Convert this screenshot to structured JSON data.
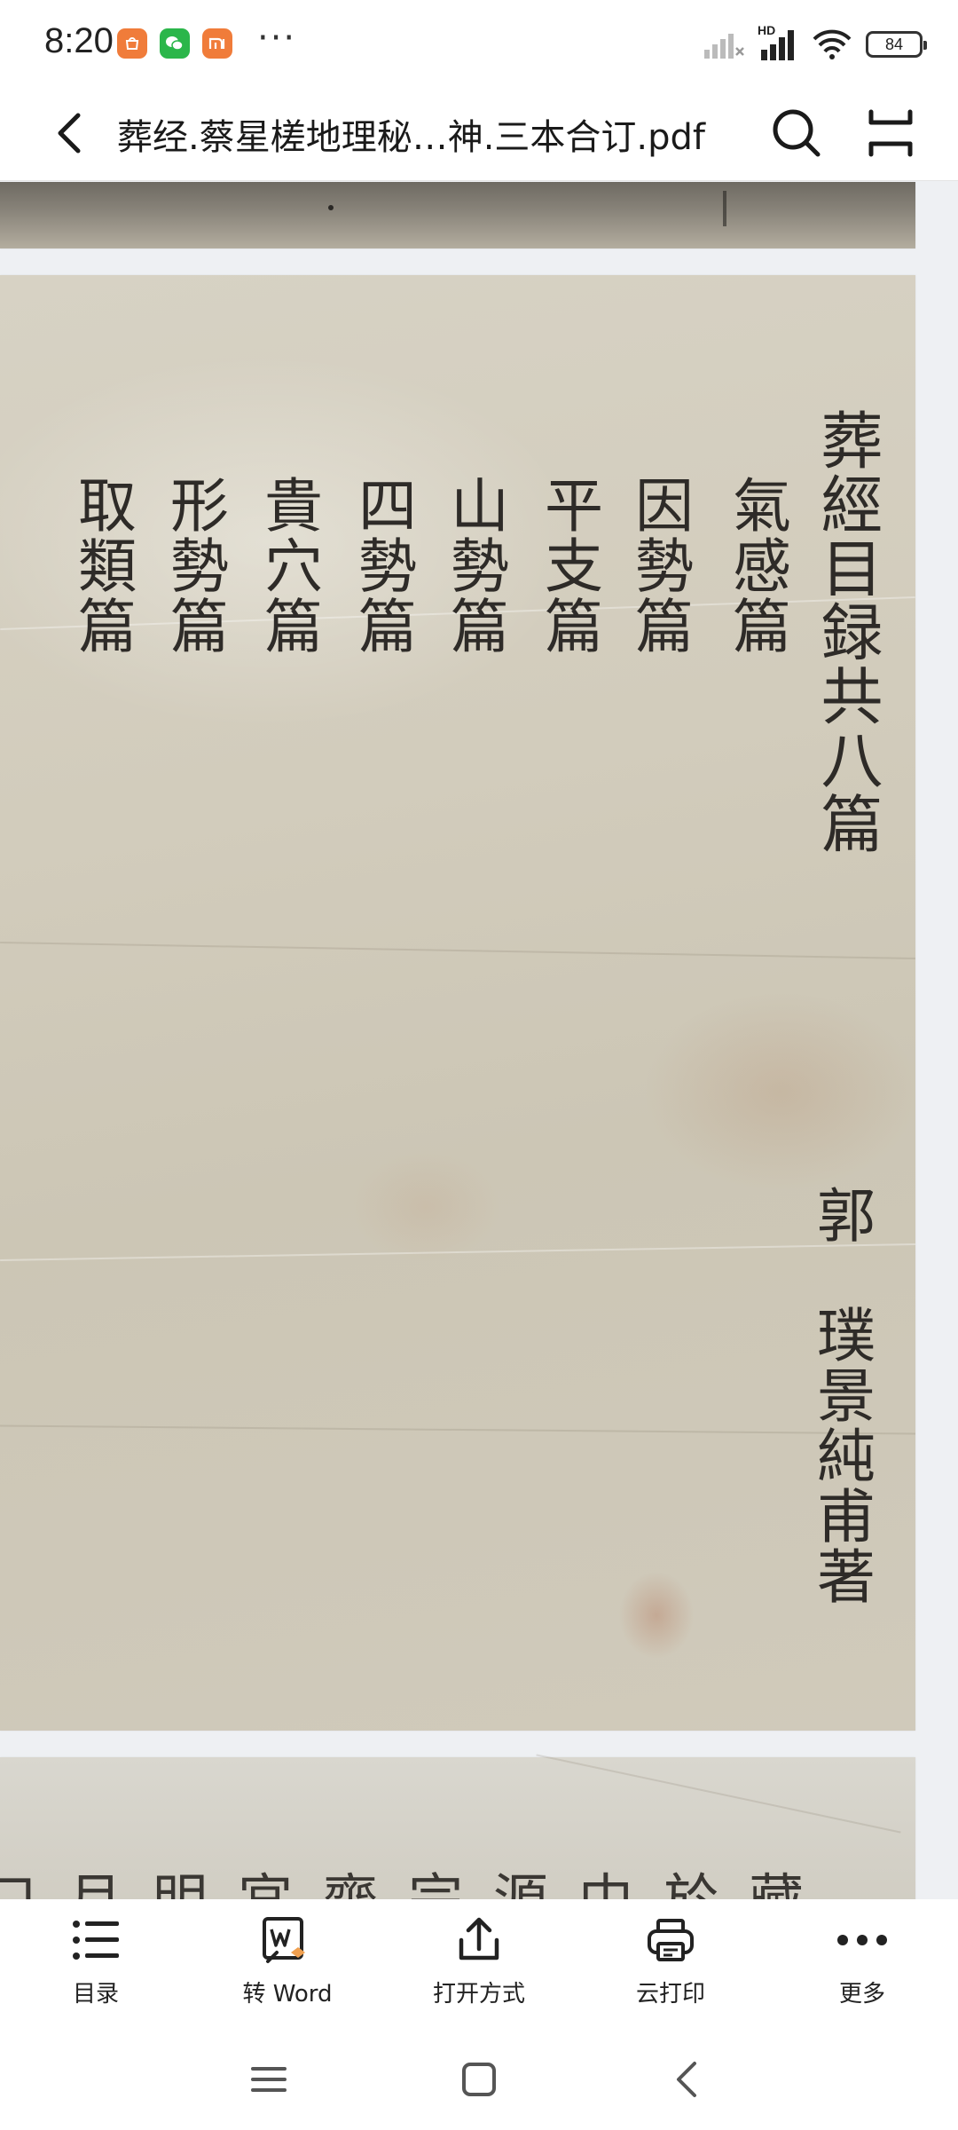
{
  "status_bar": {
    "time": "8:20",
    "notification_icons": [
      "mi-store-icon",
      "wechat-icon",
      "mi-icon"
    ],
    "more": "···",
    "network": "HD",
    "battery": "84"
  },
  "header": {
    "title": "葬经.蔡星槎地理秘…神.三本合订.pdf"
  },
  "page": {
    "columns": [
      "葬經目録共八篇",
      "氣感篇",
      "因勢篇",
      "平支篇",
      "山勢篇",
      "四勢篇",
      "貴穴篇",
      "形勢篇",
      "取類篇"
    ],
    "author_surname": "郭",
    "author_name": "璞景純甫著",
    "next_page_text": "口月明宮齊宗源中於藏"
  },
  "toolbar": {
    "items": [
      {
        "label": "目录",
        "icon": "list-icon"
      },
      {
        "label": "转 Word",
        "icon": "word-convert-icon"
      },
      {
        "label": "打开方式",
        "icon": "share-icon"
      },
      {
        "label": "云打印",
        "icon": "printer-icon"
      },
      {
        "label": "更多",
        "icon": "more-icon"
      }
    ]
  },
  "nav_bar": {
    "buttons": [
      "menu-icon",
      "home-icon",
      "back-icon"
    ]
  }
}
